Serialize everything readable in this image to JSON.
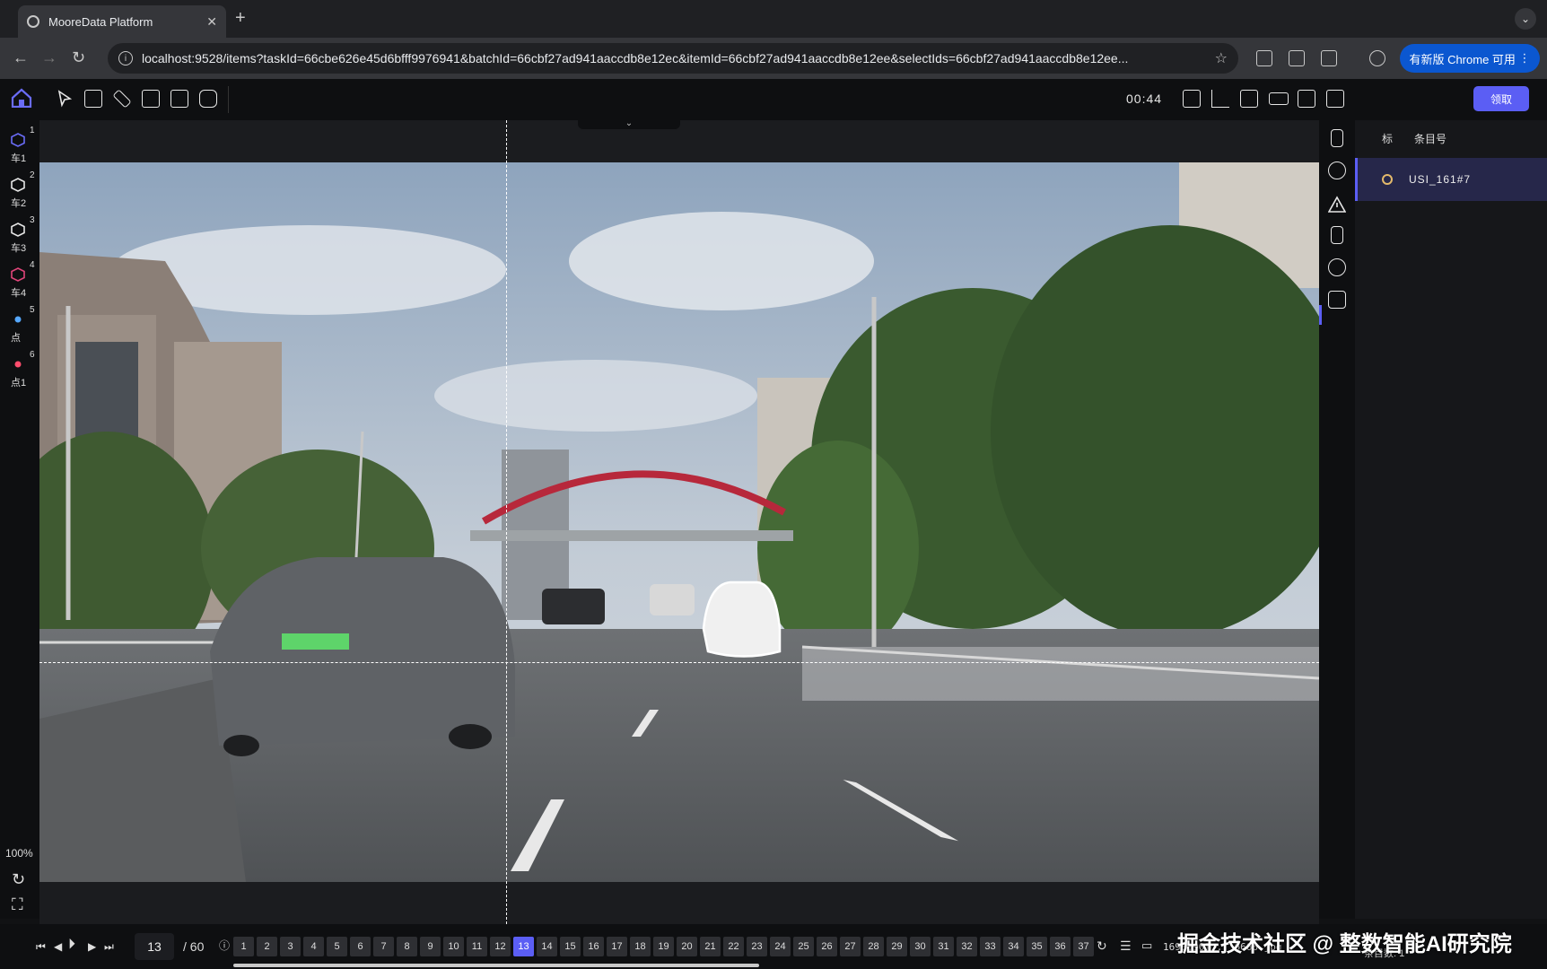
{
  "browser": {
    "tab_title": "MooreData Platform",
    "url": "localhost:9528/items?taskId=66cbe626e45d6bfff9976941&batchId=66cbf27ad941aaccdb8e12ec&itemId=66cbf27ad941aaccdb8e12ee&selectIds=66cbf27ad941aaccdb8e12ee...",
    "update_label": "有新版 Chrome 可用",
    "accent": "#0b57d0"
  },
  "app": {
    "timer": "00:44",
    "claim_label": "领取",
    "accent": "#5b5ef4",
    "zoom": "100%"
  },
  "classes": [
    {
      "num": "1",
      "label": "车1",
      "shape": "hexagon",
      "color": "#6a6cf7"
    },
    {
      "num": "2",
      "label": "车2",
      "shape": "hexagon",
      "color": "#e6e6e6"
    },
    {
      "num": "3",
      "label": "车3",
      "shape": "hexagon",
      "color": "#e6e6e6"
    },
    {
      "num": "4",
      "label": "车4",
      "shape": "hexagon",
      "color": "#e0457a"
    },
    {
      "num": "5",
      "label": "点",
      "shape": "dot",
      "color": "#56a8ff"
    },
    {
      "num": "6",
      "label": "点1",
      "shape": "dot",
      "color": "#ff4d6d"
    }
  ],
  "right_panel": {
    "col1": "标",
    "col2": "条目号",
    "item": "USI_161#7",
    "item_ring_color": "#e3b96b"
  },
  "timeline": {
    "current_frame": "13",
    "total": "/ 60",
    "frames": [
      "1",
      "2",
      "3",
      "4",
      "5",
      "6",
      "7",
      "8",
      "9",
      "10",
      "11",
      "12",
      "13",
      "14",
      "15",
      "16",
      "17",
      "18",
      "19",
      "20",
      "21",
      "22",
      "23",
      "24",
      "25",
      "26",
      "27",
      "28",
      "29",
      "30",
      "31",
      "32",
      "33",
      "34",
      "35",
      "36",
      "37"
    ],
    "active_frame": "13",
    "filename": "16938901... 6666.jpg",
    "count": "条目数: 1"
  },
  "watermark": "掘金技术社区 @ 整数智能AI研究院"
}
